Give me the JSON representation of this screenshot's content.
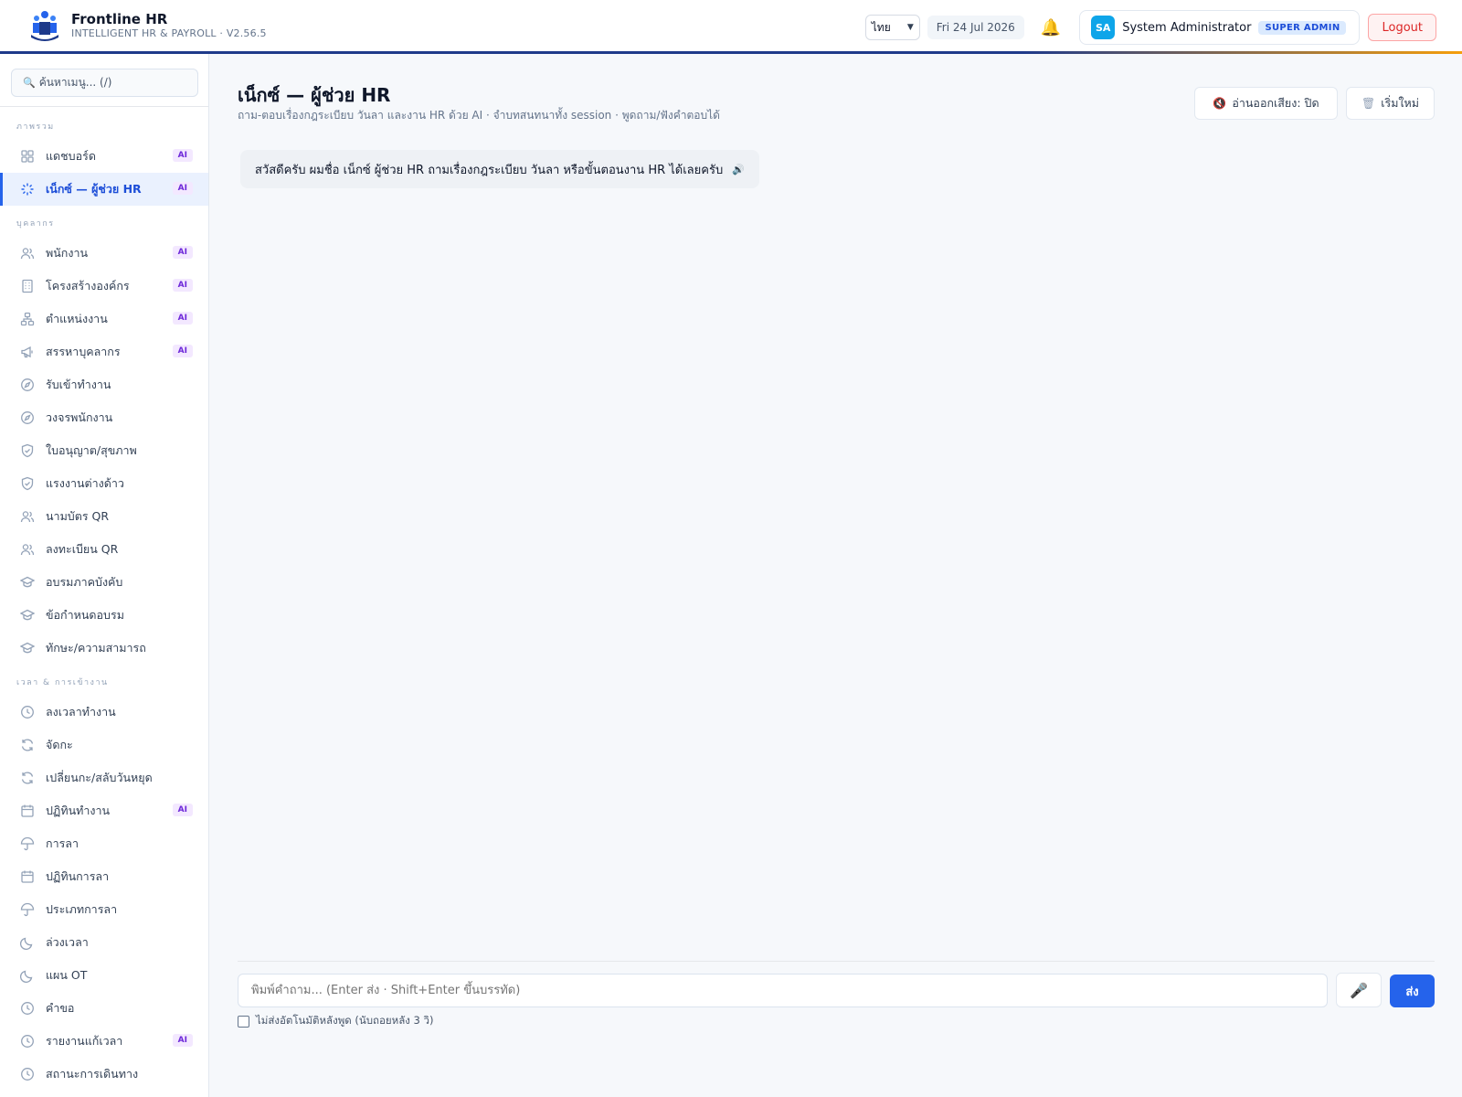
{
  "app": {
    "name": "Frontline HR",
    "subtitle": "INTELLIGENT HR & PAYROLL · V2.56.5"
  },
  "header": {
    "language": "ไทย",
    "date": "Fri 24 Jul 2026",
    "user_initials": "SA",
    "user_name": "System Administrator",
    "role": "SUPER ADMIN",
    "logout": "Logout",
    "colors": {
      "accent": "#2563eb",
      "brand_dark": "#1e3a8a",
      "brand_orange": "#f59e0b",
      "logout_red": "#dc2626"
    }
  },
  "sidebar": {
    "search_placeholder": "ค้นหาเมนู... (/)",
    "sections": [
      {
        "title": "ภาพรวม",
        "items": [
          {
            "label": "แดชบอร์ด",
            "icon": "grid-icon",
            "ai": "AI"
          },
          {
            "label": "เน็กซ์ — ผู้ช่วย HR",
            "icon": "sparkle-icon",
            "ai": "AI",
            "active": true
          }
        ]
      },
      {
        "title": "บุคลากร",
        "items": [
          {
            "label": "พนักงาน",
            "icon": "users-icon",
            "ai": "AI"
          },
          {
            "label": "โครงสร้างองค์กร",
            "icon": "building-icon",
            "ai": "AI"
          },
          {
            "label": "ตำแหน่งงาน",
            "icon": "hierarchy-icon",
            "ai": "AI"
          },
          {
            "label": "สรรหาบุคลากร",
            "icon": "megaphone-icon",
            "ai": "AI"
          },
          {
            "label": "รับเข้าทำงาน",
            "icon": "compass-icon"
          },
          {
            "label": "วงจรพนักงาน",
            "icon": "compass-icon"
          },
          {
            "label": "ใบอนุญาต/สุขภาพ",
            "icon": "shield-icon"
          },
          {
            "label": "แรงงานต่างด้าว",
            "icon": "shield-icon"
          },
          {
            "label": "นามบัตร QR",
            "icon": "users-icon"
          },
          {
            "label": "ลงทะเบียน QR",
            "icon": "users-icon"
          },
          {
            "label": "อบรมภาคบังคับ",
            "icon": "graduation-cap-icon"
          },
          {
            "label": "ข้อกำหนดอบรม",
            "icon": "graduation-cap-icon"
          },
          {
            "label": "ทักษะ/ความสามารถ",
            "icon": "graduation-cap-icon"
          }
        ]
      },
      {
        "title": "เวลา & การเข้างาน",
        "items": [
          {
            "label": "ลงเวลาทำงาน",
            "icon": "clock-icon"
          },
          {
            "label": "จัดกะ",
            "icon": "refresh-icon"
          },
          {
            "label": "เปลี่ยนกะ/สลับวันหยุด",
            "icon": "refresh-icon"
          },
          {
            "label": "ปฏิทินทำงาน",
            "icon": "calendar-icon",
            "ai": "AI"
          },
          {
            "label": "การลา",
            "icon": "umbrella-icon"
          },
          {
            "label": "ปฏิทินการลา",
            "icon": "calendar-icon"
          },
          {
            "label": "ประเภทการลา",
            "icon": "umbrella-icon"
          },
          {
            "label": "ล่วงเวลา",
            "icon": "moon-icon"
          },
          {
            "label": "แผน OT",
            "icon": "moon-icon"
          },
          {
            "label": "คำขอ",
            "icon": "clock-icon"
          },
          {
            "label": "รายงานแก้เวลา",
            "icon": "clock-icon",
            "ai": "AI"
          },
          {
            "label": "สถานะการเดินทาง",
            "icon": "clock-icon"
          }
        ]
      }
    ]
  },
  "main": {
    "title": "เน็กซ์ — ผู้ช่วย HR",
    "subtitle": "ถาม-ตอบเรื่องกฎระเบียบ วันลา และงาน HR ด้วย AI · จำบทสนทนาทั้ง session · พูดถาม/ฟังคำตอบได้",
    "tts_button": "อ่านออกเสียง: ปิด",
    "new_button": "เริ่มใหม่",
    "greeting": "สวัสดีครับ ผมชื่อ เน็กซ์ ผู้ช่วย HR ถามเรื่องกฎระเบียบ วันลา หรือขั้นตอนงาน HR ได้เลยครับ",
    "input_placeholder": "พิมพ์คำถาม... (Enter ส่ง · Shift+Enter ขึ้นบรรทัด)",
    "send_button": "ส่ง",
    "auto_send_label": "ไม่ส่งอัตโนมัติหลังพูด (นับถอยหลัง 3 วิ)"
  }
}
